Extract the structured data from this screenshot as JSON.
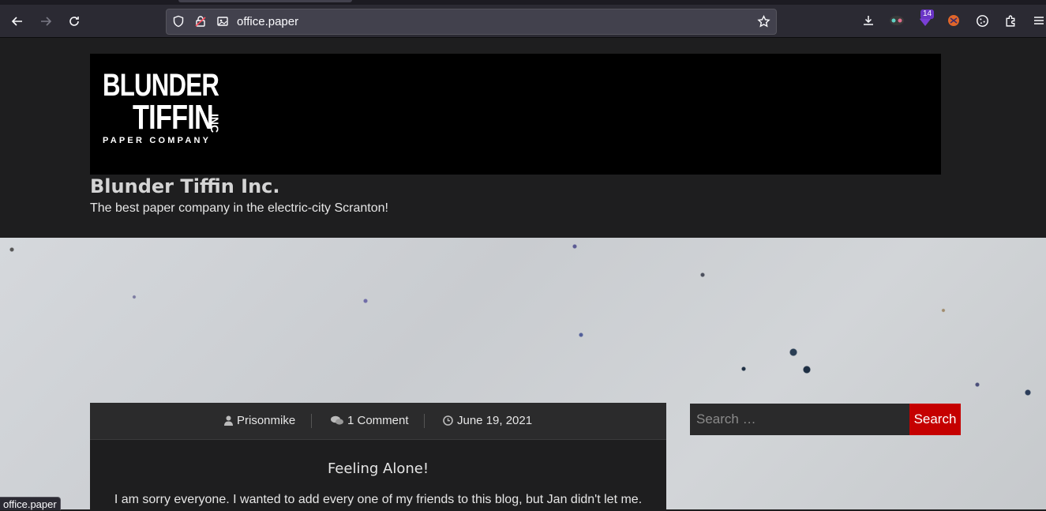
{
  "browser": {
    "url": "office.paper",
    "extension_badge_count": "14"
  },
  "site": {
    "logo_line1": "BLUNDER",
    "logo_line2": "TIFFIN",
    "logo_inc": "INC",
    "logo_tagline": "PAPER COMPANY",
    "title": "Blunder Tiffin Inc.",
    "description": "The best paper company in the electric-city Scranton!"
  },
  "post": {
    "author": "Prisonmike",
    "comments": "1 Comment",
    "date": "June 19, 2021",
    "title": "Feeling Alone!",
    "excerpt": "I am sorry everyone. I wanted to add every one of my friends to this blog, but Jan didn't let me."
  },
  "search": {
    "placeholder": "Search …",
    "button_label": "Search"
  },
  "status_bar": {
    "text": "office.paper"
  },
  "colors": {
    "accent": "#c50000",
    "header_bg": "#1e1e1f",
    "chrome_bg": "#2b2a33"
  }
}
